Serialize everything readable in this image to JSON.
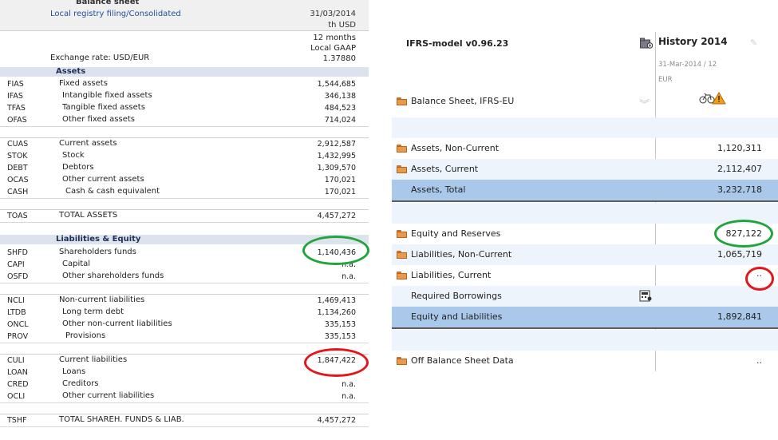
{
  "left": {
    "title": "Balance sheet",
    "filing": "Local registry filing/Consolidated",
    "date": "31/03/2014",
    "unit": "th USD",
    "months": "12 months",
    "gaap": "Local GAAP",
    "exchange_label": "Exchange rate: USD/EUR",
    "exchange_value": "1.37880",
    "assets_header": "Assets",
    "liab_header": "Liabilities & Equity",
    "rows": {
      "fias": {
        "code": "FIAS",
        "name": "Fixed assets",
        "value": "1,544,685"
      },
      "ifas": {
        "code": "IFAS",
        "name": "Intangible fixed assets",
        "value": "346,138"
      },
      "tfas": {
        "code": "TFAS",
        "name": "Tangible fixed assets",
        "value": "484,523"
      },
      "ofas": {
        "code": "OFAS",
        "name": "Other fixed assets",
        "value": "714,024"
      },
      "cuas": {
        "code": "CUAS",
        "name": "Current assets",
        "value": "2,912,587"
      },
      "stok": {
        "code": "STOK",
        "name": "Stock",
        "value": "1,432,995"
      },
      "debt": {
        "code": "DEBT",
        "name": "Debtors",
        "value": "1,309,570"
      },
      "ocas": {
        "code": "OCAS",
        "name": "Other current assets",
        "value": "170,021"
      },
      "cash": {
        "code": "CASH",
        "name": "Cash & cash equivalent",
        "value": "170,021"
      },
      "toas": {
        "code": "TOAS",
        "name": "TOTAL ASSETS",
        "value": "4,457,272"
      },
      "shfd": {
        "code": "SHFD",
        "name": "Shareholders funds",
        "value": "1,140,436"
      },
      "capi": {
        "code": "CAPI",
        "name": "Capital",
        "value": "n.a."
      },
      "osfd": {
        "code": "OSFD",
        "name": "Other shareholders funds",
        "value": "n.a."
      },
      "ncli": {
        "code": "NCLI",
        "name": "Non-current liabilities",
        "value": "1,469,413"
      },
      "ltdb": {
        "code": "LTDB",
        "name": "Long term debt",
        "value": "1,134,260"
      },
      "oncl": {
        "code": "ONCL",
        "name": "Other non-current liabilities",
        "value": "335,153"
      },
      "prov": {
        "code": "PROV",
        "name": "Provisions",
        "value": "335,153"
      },
      "culi": {
        "code": "CULI",
        "name": "Current liabilities",
        "value": "1,847,422"
      },
      "loan": {
        "code": "LOAN",
        "name": "Loans",
        "value": ""
      },
      "cred": {
        "code": "CRED",
        "name": "Creditors",
        "value": "n.a."
      },
      "ocli": {
        "code": "OCLI",
        "name": "Other current liabilities",
        "value": "n.a."
      },
      "tshf": {
        "code": "TSHF",
        "name": "TOTAL SHAREH. FUNDS & LIAB.",
        "value": "4,457,272"
      }
    }
  },
  "right": {
    "model": "IFRS-model v0.96.23",
    "history": "History 2014",
    "period": "31-Mar-2014 / 12",
    "currency": "EUR",
    "section_title": "Balance Sheet, IFRS-EU",
    "rows": {
      "anc": {
        "label": "Assets, Non-Current",
        "value": "1,120,311"
      },
      "ac": {
        "label": "Assets, Current",
        "value": "2,112,407"
      },
      "at": {
        "label": "Assets, Total",
        "value": "3,232,718"
      },
      "er": {
        "label": "Equity and Reserves",
        "value": "827,122"
      },
      "lnc": {
        "label": "Liabilities, Non-Current",
        "value": "1,065,719"
      },
      "lc": {
        "label": "Liabilities, Current",
        "value": ".."
      },
      "rb": {
        "label": "Required Borrowings",
        "value": ""
      },
      "el": {
        "label": "Equity and Liabilities",
        "value": "1,892,841"
      },
      "obs": {
        "label": "Off Balance Sheet Data",
        "value": ".."
      }
    }
  },
  "colors": {
    "highlight_green": "#21a53a",
    "highlight_red": "#e4151b",
    "total_row": "#a9c8ea",
    "folder": "#e79a4b"
  }
}
